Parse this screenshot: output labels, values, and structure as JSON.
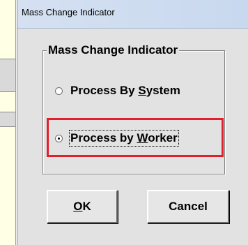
{
  "window": {
    "title": "Mass Change Indicator"
  },
  "group": {
    "legend": "Mass Change Indicator"
  },
  "options": [
    {
      "label": "Process By System",
      "selected": false,
      "accel_prefix": "Process By ",
      "accel_char": "S",
      "accel_suffix": "ystem"
    },
    {
      "label": "Process by Worker",
      "selected": true,
      "accel_prefix": "Process by ",
      "accel_char": "W",
      "accel_suffix": "orker"
    }
  ],
  "buttons": {
    "ok": {
      "label": "OK",
      "accel_char": "O",
      "rest": "K"
    },
    "cancel": {
      "label": "Cancel"
    }
  },
  "colors": {
    "highlight": "#e0202a",
    "dialog_bg": "#e2e2e2",
    "titlebar": "#d5e1f2"
  }
}
